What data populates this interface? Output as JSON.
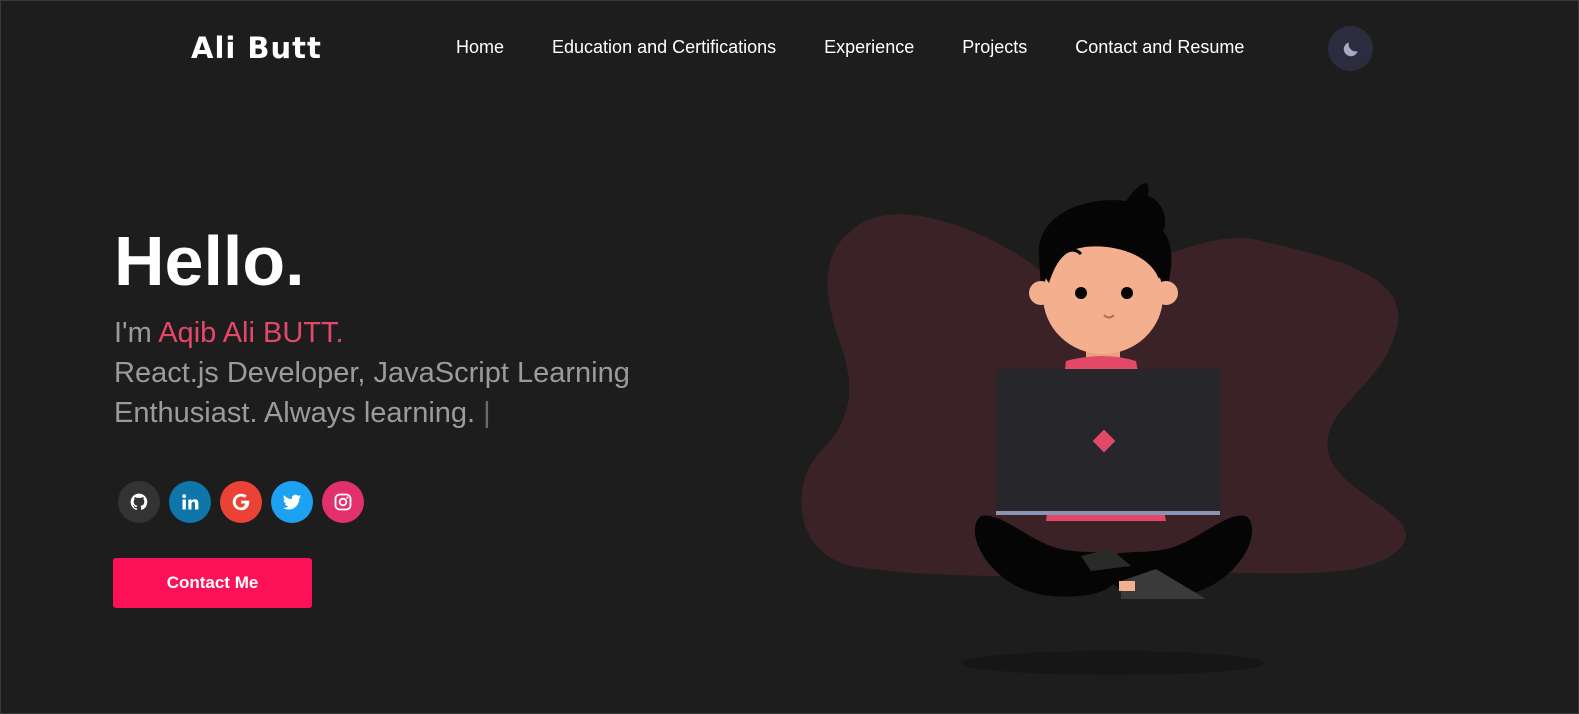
{
  "header": {
    "logo": "Ali Butt",
    "nav": [
      {
        "label": "Home"
      },
      {
        "label": "Education and Certifications"
      },
      {
        "label": "Experience"
      },
      {
        "label": "Projects"
      },
      {
        "label": "Contact and Resume"
      }
    ],
    "theme_toggle_icon": "moon-icon"
  },
  "hero": {
    "greeting": "Hello.",
    "intro_prefix": "I'm ",
    "name": "Aqib Ali BUTT.",
    "tagline": "React.js Developer, JavaScript Learning Enthusiast. Always learning.",
    "typing_cursor": "|",
    "socials": [
      {
        "icon": "github-icon",
        "color": "#333333"
      },
      {
        "icon": "linkedin-icon",
        "color": "#0e76a8"
      },
      {
        "icon": "google-icon",
        "color": "#ea4335"
      },
      {
        "icon": "twitter-icon",
        "color": "#1da1f2"
      },
      {
        "icon": "instagram-icon",
        "color": "#e1306c"
      }
    ],
    "contact_button": "Contact Me"
  },
  "colors": {
    "background": "#1d1d1d",
    "accent": "#e34869",
    "button": "#fc1056",
    "text_muted": "#9b9b9b",
    "blob": "#3a2226"
  }
}
